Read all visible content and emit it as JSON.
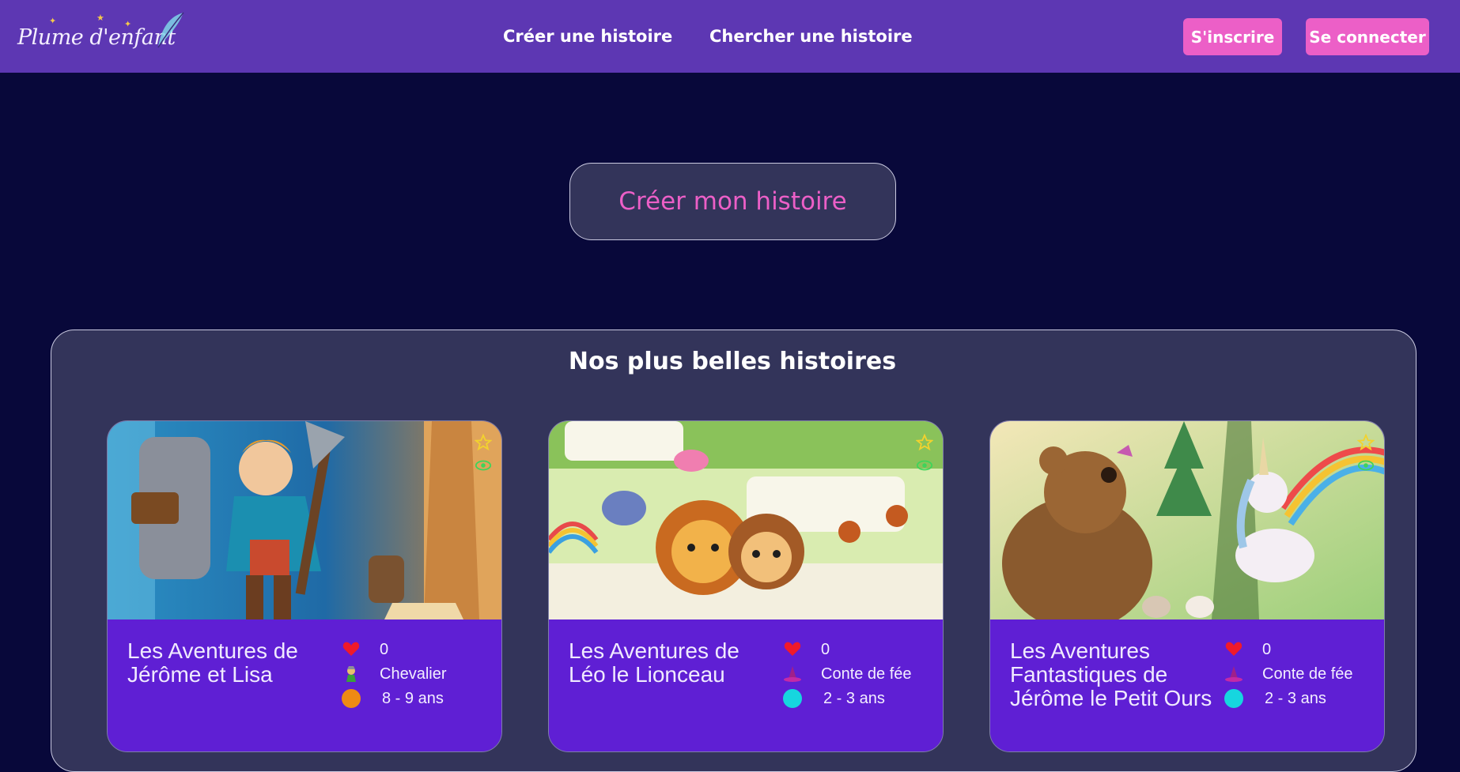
{
  "brand": {
    "name": "Plume d'enfant"
  },
  "nav": {
    "create_story": "Créer une histoire",
    "search_story": "Chercher une histoire"
  },
  "auth": {
    "signup": "S'inscrire",
    "login": "Se connecter"
  },
  "hero": {
    "create_button": "Créer mon histoire"
  },
  "section": {
    "title": "Nos plus belles histoires"
  },
  "stories": [
    {
      "title": "Les Aventures de Jérôme et Lisa",
      "likes": "0",
      "genre": "Chevalier",
      "genre_icon": "knight-icon",
      "age": "8 - 9 ans",
      "age_color": "#ee8a14"
    },
    {
      "title": "Les Aventures de Léo le Lionceau",
      "likes": "0",
      "genre": "Conte de fée",
      "genre_icon": "witch-hat-icon",
      "age": "2 - 3 ans",
      "age_color": "#16d6df"
    },
    {
      "title": "Les Aventures Fantastiques de Jérôme le Petit Ours",
      "likes": "0",
      "genre": "Conte de fée",
      "genre_icon": "witch-hat-icon",
      "age": "2 - 3 ans",
      "age_color": "#16d6df"
    }
  ],
  "colors": {
    "topbar": "#5d37b3",
    "background": "#08083a",
    "accent_pink": "#ec5fc7",
    "card_body": "#5f1fd4",
    "panel": "#33345a"
  }
}
